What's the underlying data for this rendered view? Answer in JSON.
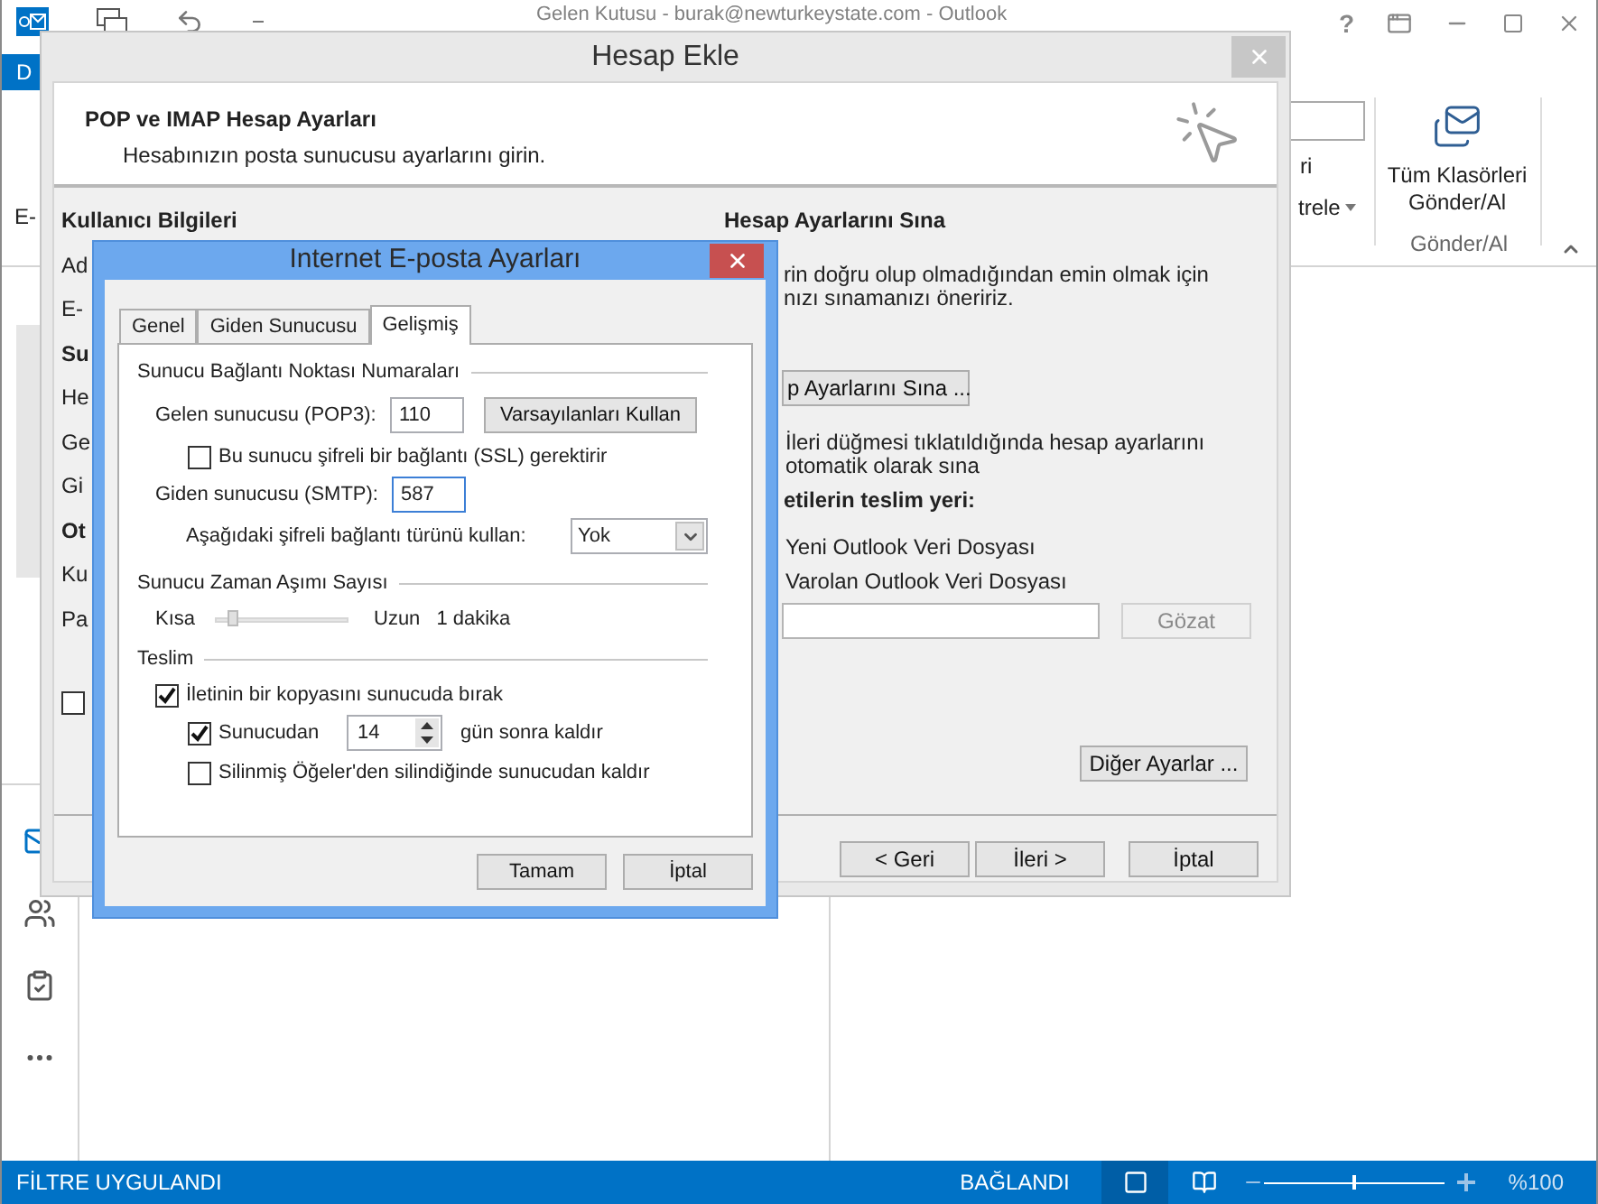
{
  "outlook": {
    "title": "Gelen Kutusu - burak@newturkeystate.com - Outlook",
    "help_glyph": "?",
    "ribbon_tab": "D",
    "left_fragment": "E-",
    "ribbon_fragments": [
      "ri",
      "trele"
    ],
    "send_receive_button": "Tüm Klasörleri Gönder/Al",
    "group_label": "Gönder/Al"
  },
  "add_account": {
    "title": "Hesap Ekle",
    "header_title": "POP ve IMAP Hesap Ayarları",
    "header_subtitle": "Hesabınızın posta sunucusu ayarlarını girin.",
    "left_labels": [
      {
        "text": "Kullanıcı Bilgileri",
        "kind": "heading"
      },
      {
        "text": "Ad",
        "kind": "label"
      },
      {
        "text": "E-",
        "kind": "label"
      },
      {
        "text": "Su",
        "kind": "heading"
      },
      {
        "text": "He",
        "kind": "label"
      },
      {
        "text": "Ge",
        "kind": "label"
      },
      {
        "text": "Gi",
        "kind": "label"
      },
      {
        "text": "Ot",
        "kind": "heading"
      },
      {
        "text": "Ku",
        "kind": "label"
      },
      {
        "text": "Pa",
        "kind": "label"
      }
    ],
    "left_checkbox": {
      "checked": false
    },
    "test_heading": "Hesap Ayarlarını Sına",
    "test_description": [
      "rin doğru olup olmadığından emin olmak için",
      "nızı sınamanızı öneririz."
    ],
    "test_button": "p Ayarlarını Sına ...",
    "auto_test": [
      "İleri düğmesi tıklatıldığında hesap ayarlarını",
      "otomatik olarak sına"
    ],
    "delivery_heading": "etilerin teslim yeri:",
    "delivery_options": [
      "Yeni Outlook Veri Dosyası",
      "Varolan Outlook Veri Dosyası"
    ],
    "browse_button": {
      "label": "Gözat",
      "disabled": true
    },
    "more_settings": "Diğer Ayarlar ...",
    "buttons": [
      "< Geri",
      "İleri >",
      "İptal"
    ]
  },
  "email_settings": {
    "title": "Internet E-posta Ayarları",
    "tabs": [
      {
        "label": "Genel",
        "selected": false
      },
      {
        "label": "Giden Sunucusu",
        "selected": false
      },
      {
        "label": "Gelişmiş",
        "selected": true
      }
    ],
    "ports": {
      "heading": "Sunucu Bağlantı Noktası Numaraları",
      "incoming_label": "Gelen sunucusu (POP3):",
      "incoming_value": "110",
      "defaults_button": "Varsayılanları Kullan",
      "ssl": {
        "label": "Bu sunucu şifreli bir bağlantı (SSL) gerektirir",
        "checked": false
      },
      "outgoing_label": "Giden sunucusu (SMTP):",
      "outgoing_value": "587",
      "encryption_label": "Aşağıdaki şifreli bağlantı türünü kullan:",
      "encryption_value": "Yok"
    },
    "timeout": {
      "heading": "Sunucu Zaman Aşımı Sayısı",
      "min_label": "Kısa",
      "max_label": "Uzun",
      "level": 0.1,
      "reading": "1 dakika"
    },
    "delivery": {
      "heading": "Teslim",
      "leave_copy": {
        "label": "İletinin bir kopyasını sunucuda bırak",
        "checked": true
      },
      "remove_after": {
        "label": "Sunucudan",
        "checked": true,
        "value": "14",
        "suffix": "gün sonra kaldır"
      },
      "remove_deleted": {
        "label": "Silinmiş Öğeler'den silindiğinde sunucudan kaldır",
        "checked": false
      }
    },
    "buttons": [
      "Tamam",
      "İptal"
    ]
  },
  "status_bar": {
    "filter": "FİLTRE UYGULANDI",
    "connection": "BAĞLANDI",
    "zoom": "%100",
    "zoom_slider": {
      "level": 0.5
    }
  }
}
